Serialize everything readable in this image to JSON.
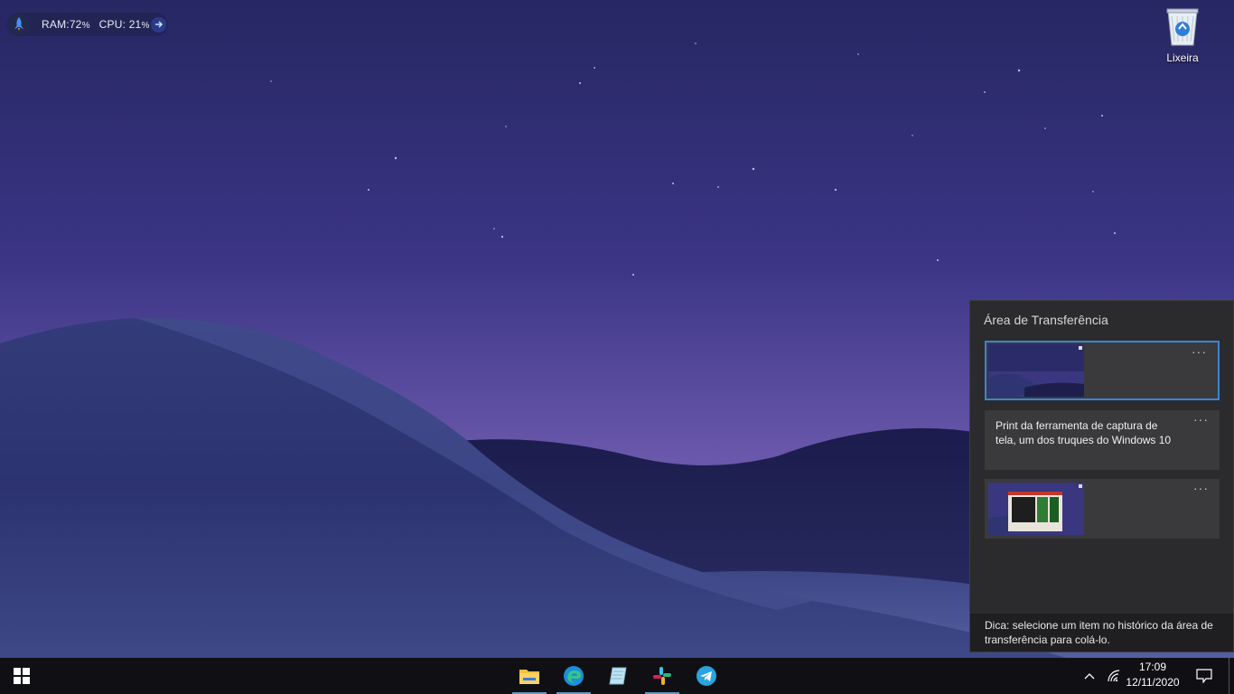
{
  "widget": {
    "ram_label": "RAM:",
    "ram_value": "72",
    "ram_unit": "%",
    "cpu_label": "CPU:",
    "cpu_value": "21",
    "cpu_unit": "%",
    "icon": "rocket-icon",
    "action_icon": "arrow-right-icon"
  },
  "desktop": {
    "recycle_bin": {
      "label": "Lixeira",
      "icon": "recycle-bin-icon"
    }
  },
  "clipboard": {
    "title": "Área de Transferência",
    "items": [
      {
        "type": "image",
        "description_icon": "screenshot-thumbnail",
        "more": "···",
        "selected": true
      },
      {
        "type": "text",
        "text": "Print da ferramenta de captura de tela, um dos truques do Windows 10",
        "more": "···"
      },
      {
        "type": "image",
        "description_icon": "screenshot-thumbnail",
        "more": "···"
      }
    ],
    "tip": "Dica: selecione um item no histórico da área de transferência para colá-lo."
  },
  "taskbar": {
    "start_icon": "windows-logo-icon",
    "apps": [
      {
        "name": "file-explorer",
        "icon": "folder-icon",
        "running": true
      },
      {
        "name": "edge",
        "icon": "edge-icon",
        "running": true
      },
      {
        "name": "notepad",
        "icon": "notepad-icon",
        "running": false
      },
      {
        "name": "slack",
        "icon": "slack-icon",
        "running": true
      },
      {
        "name": "telegram",
        "icon": "telegram-icon",
        "running": false
      }
    ],
    "tray": {
      "chevron_icon": "chevron-up-icon",
      "network_icon": "wifi-icon",
      "time": "17:09",
      "date": "12/11/2020",
      "notification_icon": "action-center-icon"
    }
  },
  "colors": {
    "accent": "#3a85d6",
    "panel": "#2b2b2d",
    "item": "#3a3a3c",
    "taskbar": "#101014"
  }
}
